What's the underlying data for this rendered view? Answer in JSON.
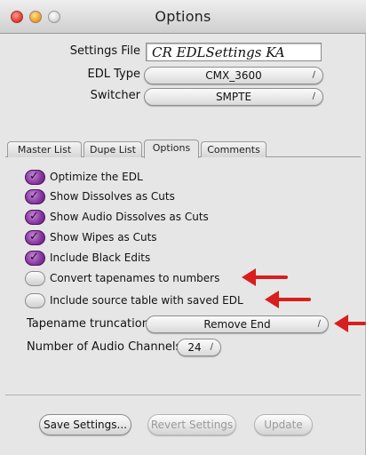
{
  "window": {
    "title": "Options"
  },
  "settings": {
    "file_label": "Settings File",
    "file_value": "CR EDLSettings KA",
    "edl_type_label": "EDL Type",
    "edl_type_value": "CMX_3600",
    "switcher_label": "Switcher",
    "switcher_value": "SMPTE"
  },
  "tabs": [
    {
      "label": "Master List",
      "active": false
    },
    {
      "label": "Dupe List",
      "active": false
    },
    {
      "label": "Options",
      "active": true
    },
    {
      "label": "Comments",
      "active": false
    }
  ],
  "options": [
    {
      "label": "Optimize the EDL",
      "checked": true
    },
    {
      "label": "Show Dissolves as Cuts",
      "checked": true
    },
    {
      "label": "Show Audio Dissolves as Cuts",
      "checked": true
    },
    {
      "label": "Show Wipes as Cuts",
      "checked": true
    },
    {
      "label": "Include Black Edits",
      "checked": true
    },
    {
      "label": "Convert tapenames to numbers",
      "checked": false
    },
    {
      "label": "Include source table with saved EDL",
      "checked": false
    }
  ],
  "tapename_truncation": {
    "label": "Tapename truncation",
    "value": "Remove End"
  },
  "audio_channels": {
    "label": "Number of Audio Channels",
    "value": "24"
  },
  "buttons": {
    "save": "Save Settings...",
    "revert": "Revert Settings",
    "update": "Update"
  },
  "colors": {
    "checkbox_on": "#8a3aa2",
    "annotation_arrow": "#d81e1e"
  },
  "icons": {
    "popup_chevron": "chevron-up-down-icon",
    "checkmark": "checkmark-icon",
    "annotation": "red-arrow-icon"
  }
}
